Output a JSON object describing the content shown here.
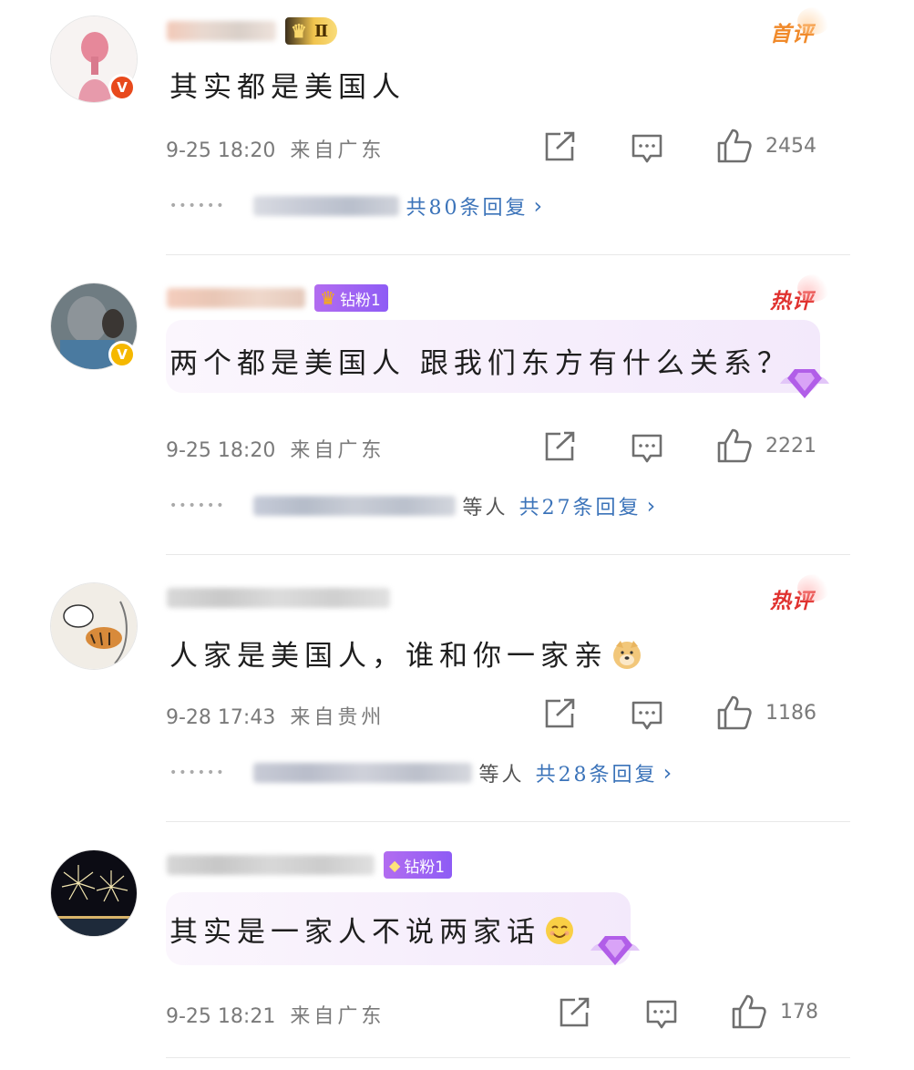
{
  "comments": [
    {
      "badge_level": "Ⅱ",
      "tag": "首评",
      "text": "其实都是美国人",
      "time": "9-25 18:20",
      "location": "来自广东",
      "likes": "2454",
      "reply_others": "",
      "reply_total": "共80条回复",
      "reply_chevron": "›"
    },
    {
      "fan_badge": "钻粉1",
      "tag": "热评",
      "text": "两个都是美国人 跟我们东方有什么关系？",
      "time": "9-25 18:20",
      "location": "来自广东",
      "likes": "2221",
      "reply_others": "等人",
      "reply_total": "共27条回复",
      "reply_chevron": "›"
    },
    {
      "tag": "热评",
      "text": "人家是美国人，谁和你一家亲",
      "emoji": "doge-emoji",
      "time": "9-28 17:43",
      "location": "来自贵州",
      "likes": "1186",
      "reply_others": "等人",
      "reply_total": "共28条回复",
      "reply_chevron": "›"
    },
    {
      "fan_badge": "钻粉1",
      "text": "其实是一家人不说两家话",
      "emoji": "smile-emoji",
      "time": "9-25 18:21",
      "location": "来自广东",
      "likes": "178"
    }
  ],
  "colors": {
    "link": "#3b73b9",
    "meta": "#7a7a7a",
    "first_tag": "#f08a2b",
    "hot_tag": "#e0322f",
    "fan_badge": "#8e5cf5"
  },
  "icons": [
    "share-icon",
    "comment-icon",
    "like-icon",
    "verified-badge-icon",
    "chevron-right-icon"
  ]
}
